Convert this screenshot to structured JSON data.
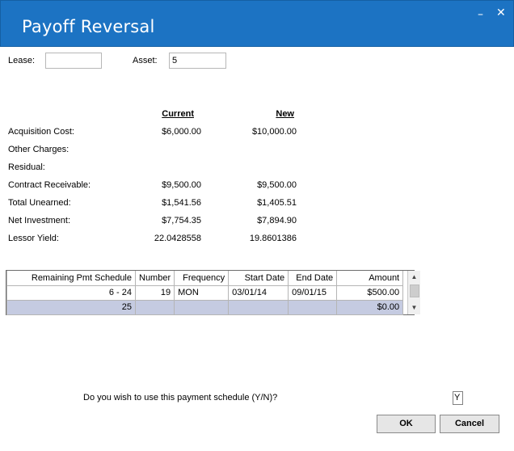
{
  "window": {
    "title": "Payoff Reversal",
    "minimize_glyph": "–",
    "close_glyph": "✕"
  },
  "fields": {
    "lease_label": "Lease:",
    "lease_value": "",
    "asset_label": "Asset:",
    "asset_value": "5"
  },
  "comparison": {
    "current_header": "Current",
    "new_header": "New",
    "rows": [
      {
        "label": "Acquisition Cost:",
        "current": "$6,000.00",
        "new": "$10,000.00"
      },
      {
        "label": "Other Charges:",
        "current": "",
        "new": ""
      },
      {
        "label": "Residual:",
        "current": "",
        "new": ""
      },
      {
        "label": "Contract Receivable:",
        "current": "$9,500.00",
        "new": "$9,500.00"
      },
      {
        "label": "Total Unearned:",
        "current": "$1,541.56",
        "new": "$1,405.51"
      },
      {
        "label": "Net Investment:",
        "current": "$7,754.35",
        "new": "$7,894.90"
      },
      {
        "label": "Lessor Yield:",
        "current": "22.0428558",
        "new": "19.8601386"
      }
    ]
  },
  "schedule": {
    "columns": [
      "Remaining Pmt Schedule",
      "Number",
      "Frequency",
      "Start Date",
      "End Date",
      "Amount"
    ],
    "rows": [
      {
        "range": "6 -  24",
        "number": "19",
        "frequency": "MON",
        "start": "03/01/14",
        "end": "09/01/15",
        "amount": "$500.00"
      },
      {
        "range": "25",
        "number": "",
        "frequency": "",
        "start": "",
        "end": "",
        "amount": "$0.00"
      }
    ]
  },
  "prompt": {
    "question": "Do you wish to use this payment schedule (Y/N)?",
    "answer": "Y"
  },
  "buttons": {
    "ok": "OK",
    "cancel": "Cancel"
  },
  "colors": {
    "titlebar": "#1c73c3",
    "highlight_row": "#c5cbe1"
  }
}
